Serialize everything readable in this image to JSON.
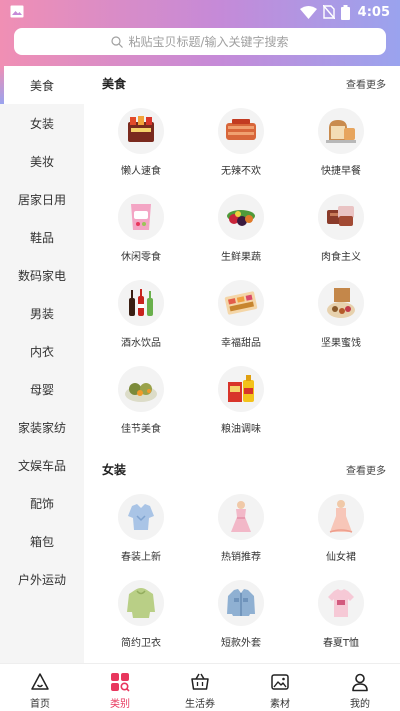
{
  "status": {
    "time": "4:05"
  },
  "search": {
    "placeholder": "粘贴宝贝标题/输入关键字搜索"
  },
  "colors": {
    "accent": "#e8365d",
    "gradient_start": "#f08fb4",
    "gradient_end": "#9aa3ee"
  },
  "sidebar": {
    "active_index": 0,
    "items": [
      {
        "label": "美食"
      },
      {
        "label": "女装"
      },
      {
        "label": "美妆"
      },
      {
        "label": "居家日用"
      },
      {
        "label": "鞋品"
      },
      {
        "label": "数码家电"
      },
      {
        "label": "男装"
      },
      {
        "label": "内衣"
      },
      {
        "label": "母婴"
      },
      {
        "label": "家装家纺"
      },
      {
        "label": "文娱车品"
      },
      {
        "label": "配饰"
      },
      {
        "label": "箱包"
      },
      {
        "label": "户外运动"
      }
    ]
  },
  "sections": [
    {
      "title": "美食",
      "more": "查看更多",
      "items": [
        {
          "label": "懒人速食",
          "icon": "instant-food-icon"
        },
        {
          "label": "无辣不欢",
          "icon": "spicy-meat-icon"
        },
        {
          "label": "快捷早餐",
          "icon": "bread-icon"
        },
        {
          "label": "休闲零食",
          "icon": "snack-bag-icon"
        },
        {
          "label": "生鲜果蔬",
          "icon": "fruit-icon"
        },
        {
          "label": "肉食主义",
          "icon": "meat-icon"
        },
        {
          "label": "酒水饮品",
          "icon": "bottles-icon"
        },
        {
          "label": "幸福甜品",
          "icon": "dessert-box-icon"
        },
        {
          "label": "坚果蜜饯",
          "icon": "nuts-icon"
        },
        {
          "label": "佳节美食",
          "icon": "festival-food-icon"
        },
        {
          "label": "粮油调味",
          "icon": "oil-bottle-icon"
        }
      ]
    },
    {
      "title": "女装",
      "more": "查看更多",
      "items": [
        {
          "label": "春装上新",
          "icon": "blouse-icon"
        },
        {
          "label": "热销推荐",
          "icon": "dress-icon"
        },
        {
          "label": "仙女裙",
          "icon": "fairy-dress-icon"
        },
        {
          "label": "简约卫衣",
          "icon": "hoodie-icon"
        },
        {
          "label": "短款外套",
          "icon": "denim-jacket-icon"
        },
        {
          "label": "春夏T恤",
          "icon": "tshirt-icon"
        }
      ]
    }
  ],
  "bottom_nav": {
    "active_index": 1,
    "items": [
      {
        "label": "首页",
        "icon": "home-icon"
      },
      {
        "label": "类别",
        "icon": "category-icon"
      },
      {
        "label": "生活券",
        "icon": "basket-icon"
      },
      {
        "label": "素材",
        "icon": "image-icon"
      },
      {
        "label": "我的",
        "icon": "user-icon"
      }
    ]
  }
}
